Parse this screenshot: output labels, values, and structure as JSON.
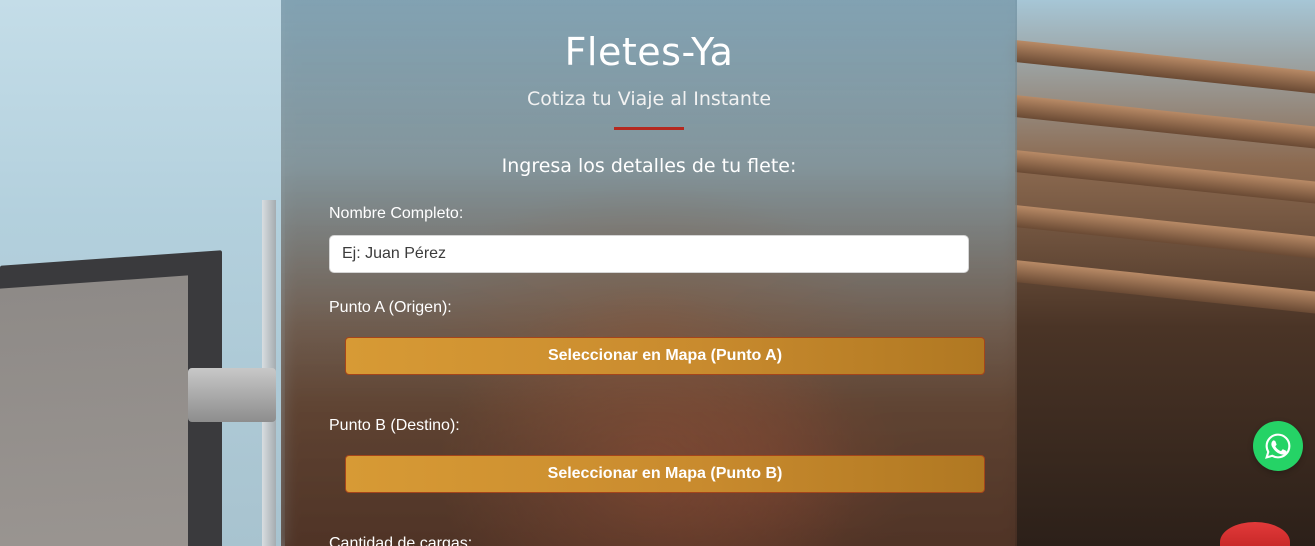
{
  "header": {
    "title": "Fletes-Ya",
    "subtitle": "Cotiza tu Viaje al Instante",
    "accent_color": "#b5281f"
  },
  "form": {
    "heading": "Ingresa los detalles de tu flete:",
    "name_label": "Nombre Completo:",
    "name_placeholder": "Ej: Juan Pérez",
    "name_value": "",
    "origin_label": "Punto A (Origen):",
    "origin_button": "Seleccionar en Mapa (Punto A)",
    "destination_label": "Punto B (Destino):",
    "destination_button": "Seleccionar en Mapa (Punto B)",
    "loads_label": "Cantidad de cargas:",
    "button_color": "#d79a35"
  },
  "floating": {
    "whatsapp_icon": "whatsapp-icon",
    "whatsapp_color": "#25d366"
  }
}
